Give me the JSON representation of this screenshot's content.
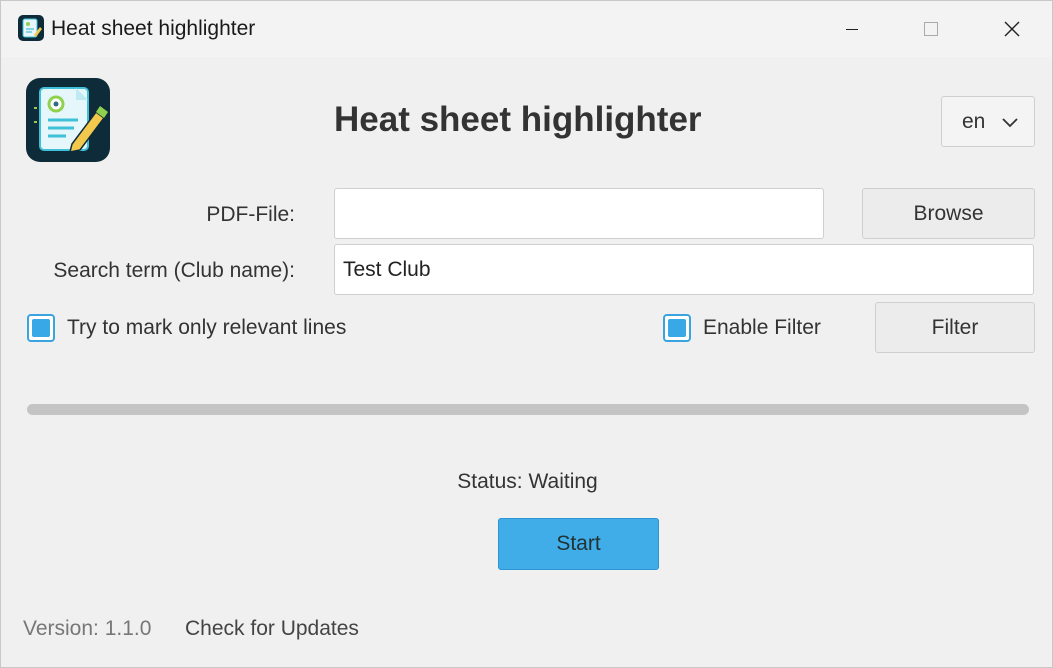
{
  "window": {
    "title": "Heat sheet highlighter",
    "controls": {
      "minimize": "minimize-icon",
      "maximize": "maximize-icon",
      "close": "close-icon"
    }
  },
  "header": {
    "heading": "Heat sheet highlighter",
    "logo_icon": "document-pen-icon",
    "language": {
      "selected": "en"
    }
  },
  "form": {
    "pdf_file": {
      "label": "PDF-File:",
      "value": "",
      "placeholder": ""
    },
    "browse_label": "Browse",
    "search_term": {
      "label": "Search term (Club name):",
      "value": "Test Club"
    },
    "mark_relevant": {
      "label": "Try to mark only relevant lines",
      "checked": true
    },
    "enable_filter": {
      "label": "Enable Filter",
      "checked": true
    },
    "filter_label": "Filter"
  },
  "progress": {
    "value": 0
  },
  "status": {
    "text": "Status: Waiting"
  },
  "start_label": "Start",
  "footer": {
    "version": "Version: 1.1.0",
    "check_updates": "Check for Updates"
  },
  "colors": {
    "accent": "#3aa4df",
    "start_button": "#40ade9",
    "background": "#f0f0f0",
    "logo_bg": "#0e2b3a"
  }
}
